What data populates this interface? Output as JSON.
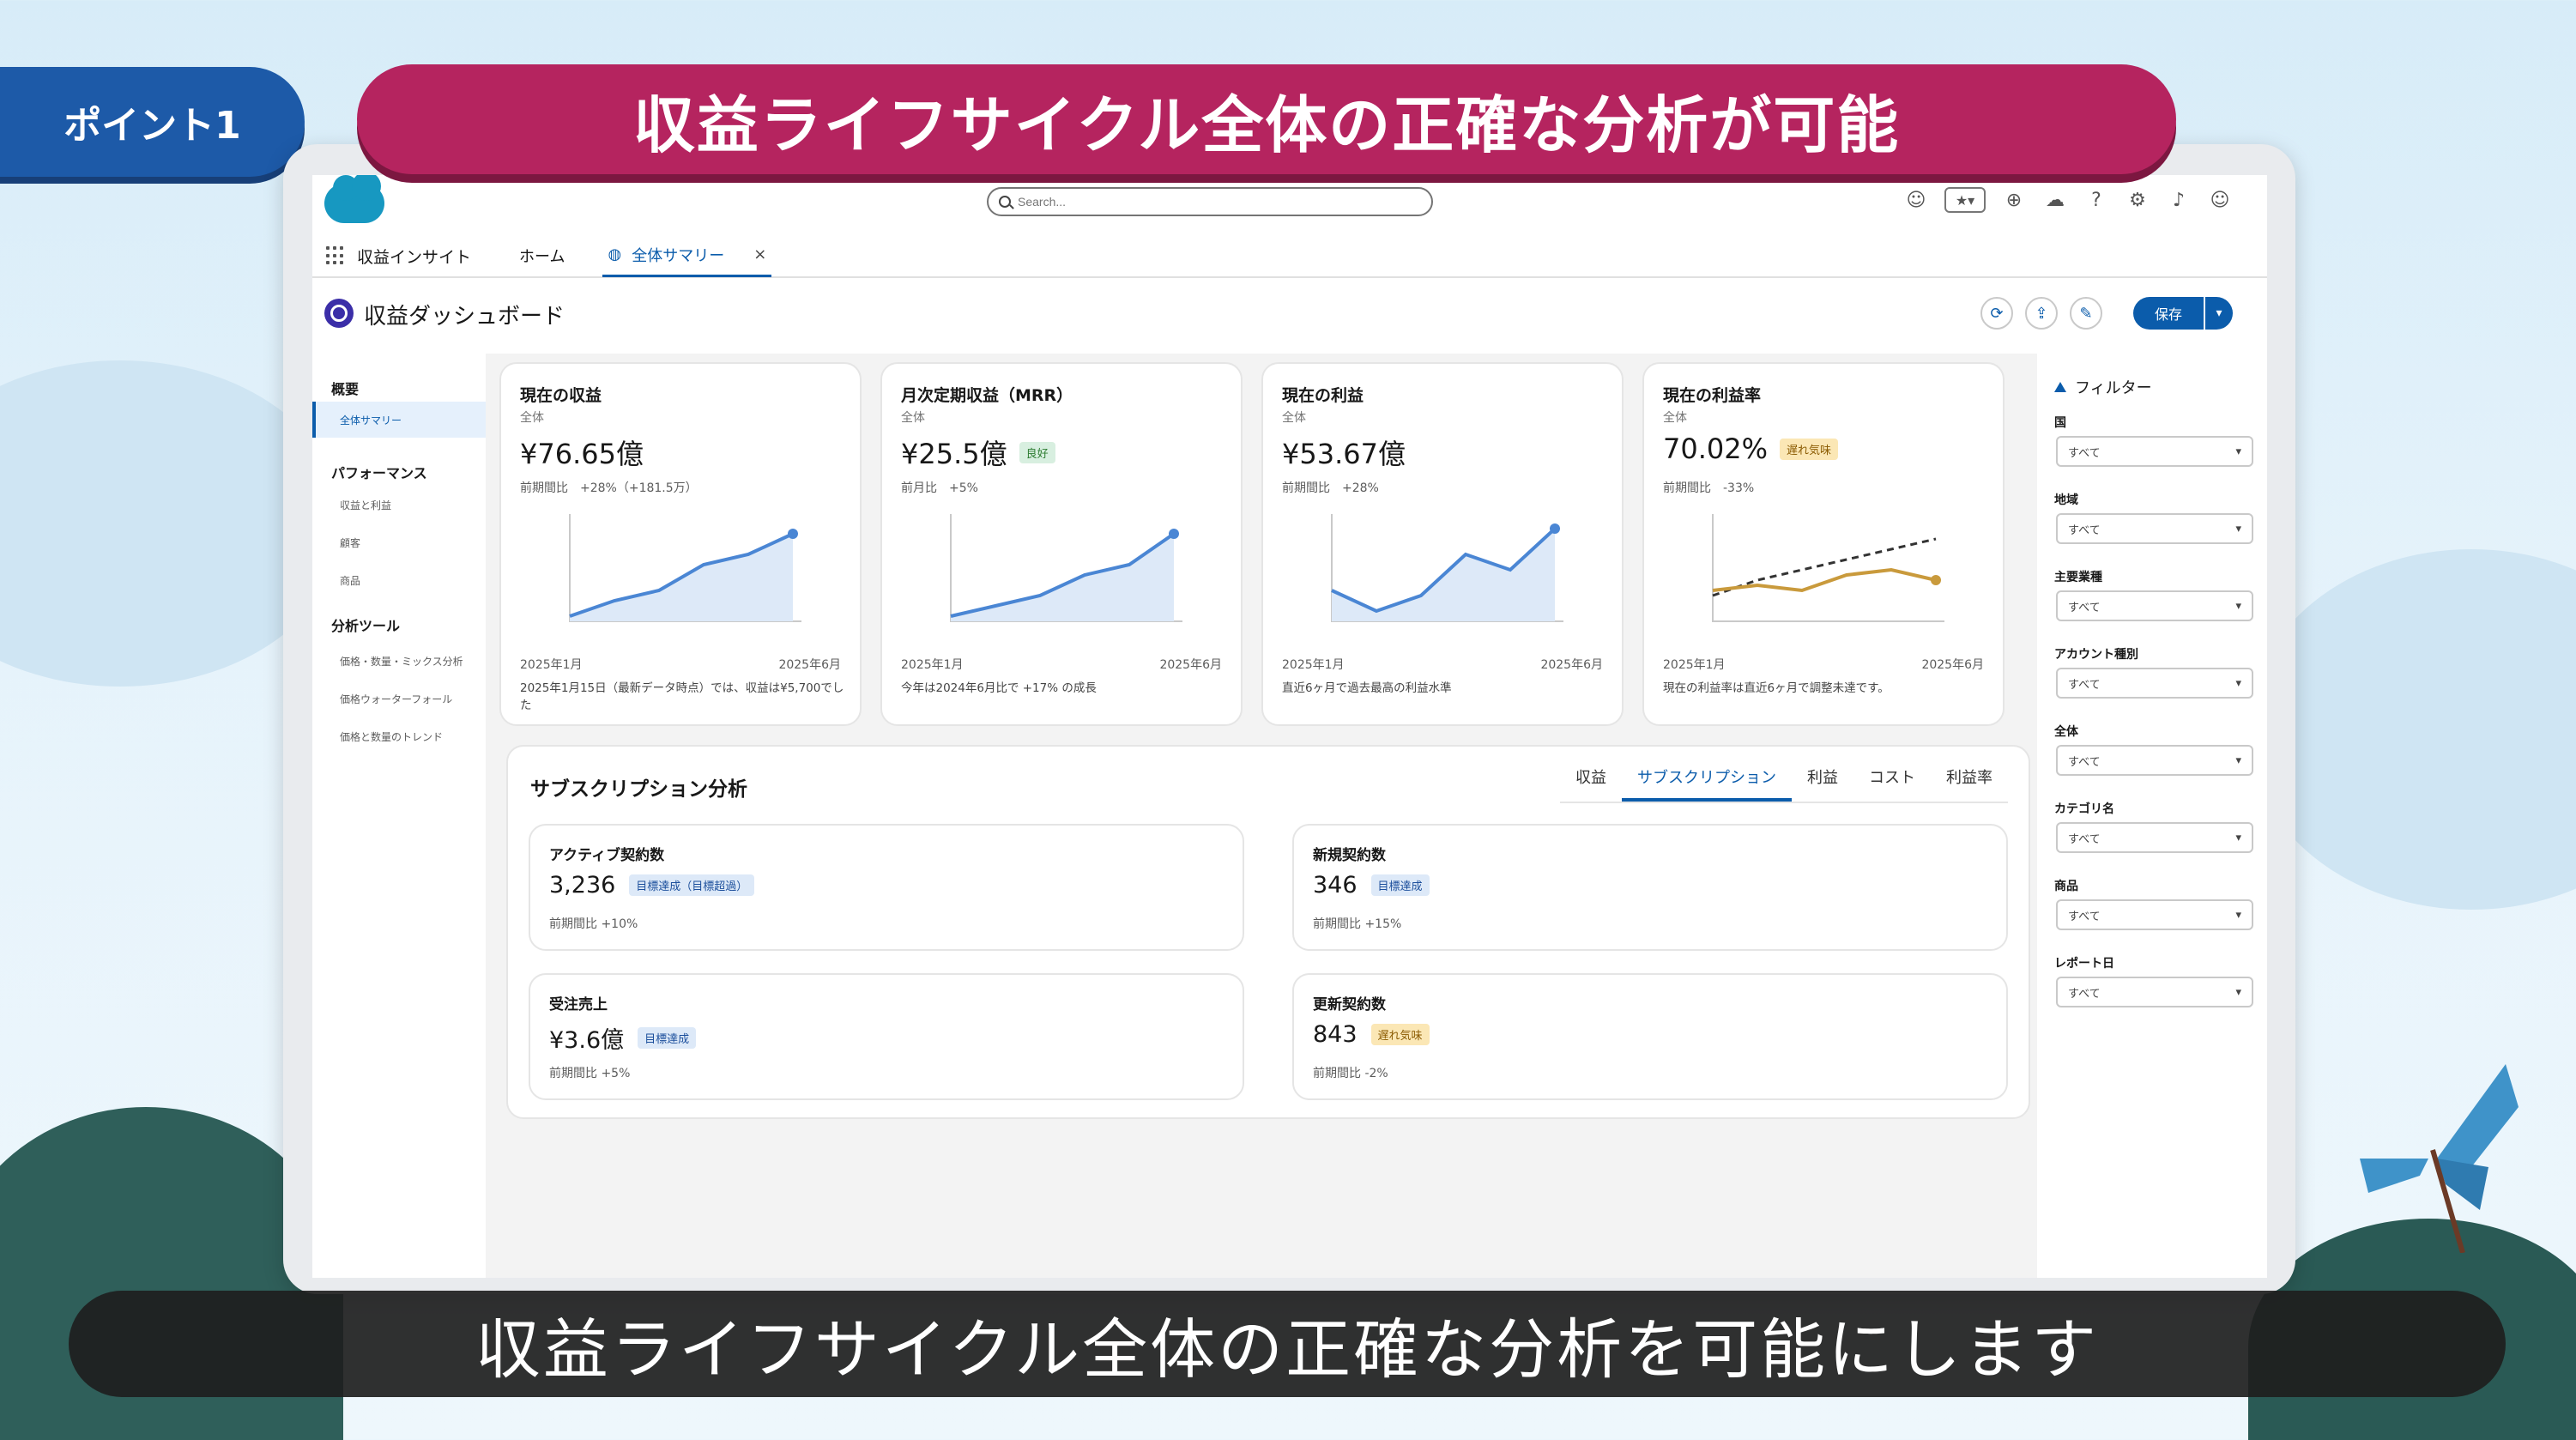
{
  "badge": "ポイント1",
  "banner_title": "収益ライフサイクル全体の正確な分析が可能",
  "subtitle": "収益ライフサイクル全体の正確な分析を可能にします",
  "topbar": {
    "search_placeholder": "Search..."
  },
  "nav": {
    "app_name": "収益インサイト",
    "home": "ホーム",
    "tab": "全体サマリー",
    "close": "×"
  },
  "header": {
    "title": "収益ダッシュボード",
    "save": "保存",
    "caret": "▾",
    "refresh_icon": "⟳",
    "share_icon": "⇪",
    "edit_icon": "✎"
  },
  "sidebar": {
    "overview": "概要",
    "active_item": "全体サマリー",
    "performance": "パフォーマンス",
    "performance_items": [
      "収益と利益",
      "顧客",
      "商品"
    ],
    "tools": "分析ツール",
    "tools_items": [
      "価格・数量・ミックス分析",
      "価格ウォーターフォール",
      "価格と数量のトレンド"
    ]
  },
  "kpis": [
    {
      "title": "現在の収益",
      "scope": "全体",
      "value": "¥76.65億",
      "badge": "",
      "change": "前期間比　+28%（+181.5万）",
      "x_start": "2025年1月",
      "x_end": "2025年6月",
      "note": "2025年1月15日（最新データ時点）では、収益は¥5,700でした"
    },
    {
      "title": "月次定期収益（MRR）",
      "scope": "全体",
      "value": "¥25.5億",
      "badge": "良好",
      "change": "前月比　+5%",
      "x_start": "2025年1月",
      "x_end": "2025年6月",
      "note": "今年は2024年6月比で +17% の成長"
    },
    {
      "title": "現在の利益",
      "scope": "全体",
      "value": "¥53.67億",
      "badge": "",
      "change": "前期間比　+28%",
      "x_start": "2025年1月",
      "x_end": "2025年6月",
      "note": "直近6ヶ月で過去最高の利益水準"
    },
    {
      "title": "現在の利益率",
      "scope": "全体",
      "value": "70.02%",
      "badge": "遅れ気味",
      "change": "前期間比　-33%",
      "x_start": "2025年1月",
      "x_end": "2025年6月",
      "note": "現在の利益率は直近6ヶ月で調整未達です。"
    }
  ],
  "kpi_trends": [
    {
      "values": [
        0.05,
        0.2,
        0.3,
        0.55,
        0.65,
        0.85
      ]
    },
    {
      "values": [
        0.05,
        0.15,
        0.25,
        0.45,
        0.55,
        0.85
      ]
    },
    {
      "values": [
        0.3,
        0.1,
        0.25,
        0.65,
        0.5,
        0.9
      ]
    },
    {
      "values": [
        0.3,
        0.35,
        0.3,
        0.45,
        0.5,
        0.4
      ],
      "target": [
        0.25,
        0.4,
        0.5,
        0.6,
        0.7,
        0.8
      ]
    }
  ],
  "colors": {
    "line_blue": "#4a86d4",
    "area_blue": "#dde9f8",
    "line_gold": "#c99a3c",
    "accent": "#0b5cab",
    "banner": "#b5245f",
    "badge": "#1d5aa8"
  },
  "subscription": {
    "title": "サブスクリプション分析",
    "tabs": [
      "収益",
      "サブスクリプション",
      "利益",
      "コスト",
      "利益率"
    ],
    "metrics": [
      {
        "title": "アクティブ契約数",
        "value": "3,236",
        "badge": "目標達成（目標超過）",
        "change": "前期間比 +10%"
      },
      {
        "title": "新規契約数",
        "value": "346",
        "badge": "目標達成",
        "change": "前期間比 +15%"
      },
      {
        "title": "受注売上",
        "value": "¥3.6億",
        "badge": "目標達成",
        "change": "前期間比 +5%"
      },
      {
        "title": "更新契約数",
        "value": "843",
        "badge": "遅れ気味",
        "change": "前期間比 -2%"
      }
    ]
  },
  "filters": {
    "title": "フィルター",
    "items": [
      {
        "label": "国",
        "value": "すべて"
      },
      {
        "label": "地域",
        "value": "すべて"
      },
      {
        "label": "主要業種",
        "value": "すべて"
      },
      {
        "label": "アカウント種別",
        "value": "すべて"
      },
      {
        "label": "全体",
        "value": "すべて"
      },
      {
        "label": "カテゴリ名",
        "value": "すべて"
      },
      {
        "label": "商品",
        "value": "すべて"
      },
      {
        "label": "レポート日",
        "value": "すべて"
      }
    ]
  }
}
